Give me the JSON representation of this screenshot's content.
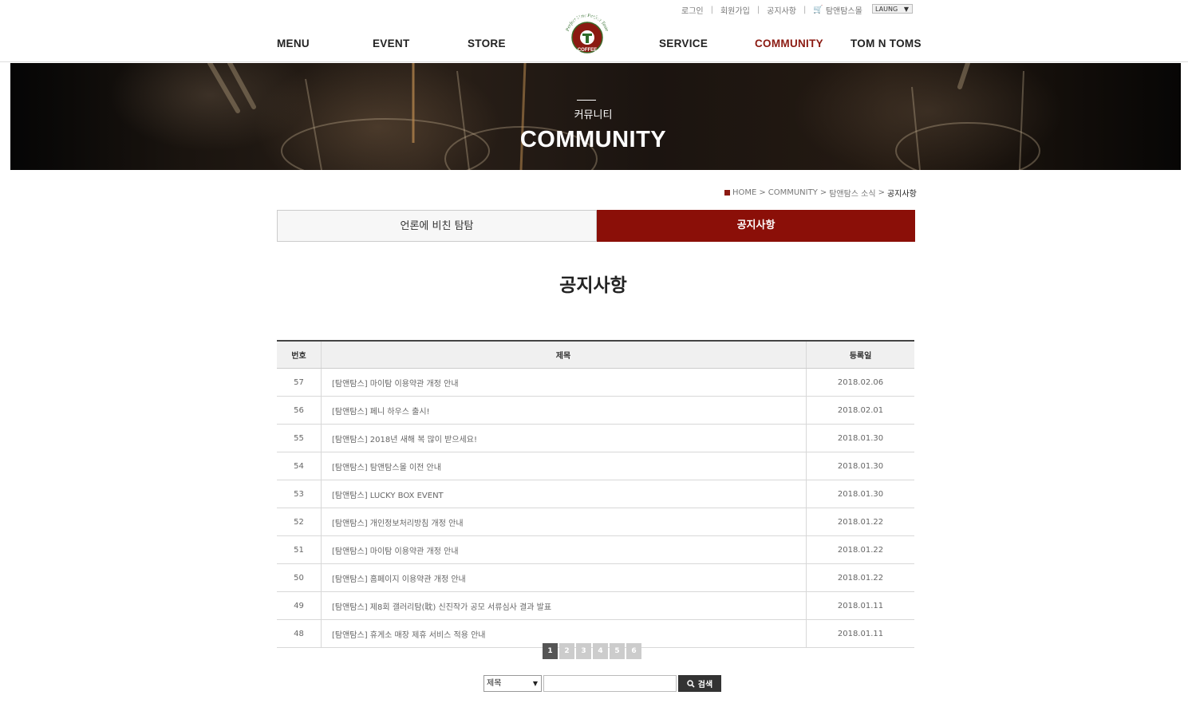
{
  "util": {
    "login": "로그인",
    "signup": "회원가입",
    "notice": "공지사항",
    "shop": "탐앤탐스몰",
    "lang": "LAUNG"
  },
  "nav": {
    "menu": "MENU",
    "event": "EVENT",
    "store": "STORE",
    "service": "SERVICE",
    "community": "COMMUNITY",
    "tomntoms": "TOM N TOMS"
  },
  "logo": {
    "top": "Perfect Time Perfect Taste",
    "brand": "TOM N TOMS",
    "sub": "COFFEE"
  },
  "hero": {
    "sub": "커뮤니티",
    "title": "COMMUNITY"
  },
  "breadcrumb": {
    "home": "HOME",
    "level1": "COMMUNITY",
    "level2": "탐앤탐스 소식",
    "current": "공지사항"
  },
  "tabs": {
    "press": "언론에 비친 탐탐",
    "notice": "공지사항"
  },
  "page_title": "공지사항",
  "table": {
    "headers": {
      "no": "번호",
      "title": "제목",
      "date": "등록일"
    },
    "rows": [
      {
        "no": "57",
        "title": "[탐앤탐스] 마이탐 이용약관 개정 안내",
        "date": "2018.02.06"
      },
      {
        "no": "56",
        "title": "[탐앤탐스] 페니 하우스 출시!",
        "date": "2018.02.01"
      },
      {
        "no": "55",
        "title": "[탐앤탐스] 2018년 새해 복 많이 받으세요!",
        "date": "2018.01.30"
      },
      {
        "no": "54",
        "title": "[탐앤탐스] 탐앤탐스몰 이전 안내",
        "date": "2018.01.30"
      },
      {
        "no": "53",
        "title": "[탐앤탐스] LUCKY BOX EVENT",
        "date": "2018.01.30"
      },
      {
        "no": "52",
        "title": "[탐앤탐스] 개인정보처리방침 개정 안내",
        "date": "2018.01.22"
      },
      {
        "no": "51",
        "title": "[탐앤탐스] 마이탐 이용약관 개정 안내",
        "date": "2018.01.22"
      },
      {
        "no": "50",
        "title": "[탐앤탐스] 홈페이지 이용약관 개정 안내",
        "date": "2018.01.22"
      },
      {
        "no": "49",
        "title": "[탐앤탐스] 제8회 갤러리탐(耽) 신진작가 공모 서류심사 결과 발표",
        "date": "2018.01.11"
      },
      {
        "no": "48",
        "title": "[탐앤탐스] 휴게소 매장 제휴 서비스 적용 안내",
        "date": "2018.01.11"
      }
    ]
  },
  "pager": [
    "1",
    "2",
    "3",
    "4",
    "5",
    "6"
  ],
  "search": {
    "field": "제목",
    "value": "",
    "button": "검색"
  },
  "colors": {
    "brand": "#8b0f08",
    "active_nav": "#8b1a12"
  }
}
